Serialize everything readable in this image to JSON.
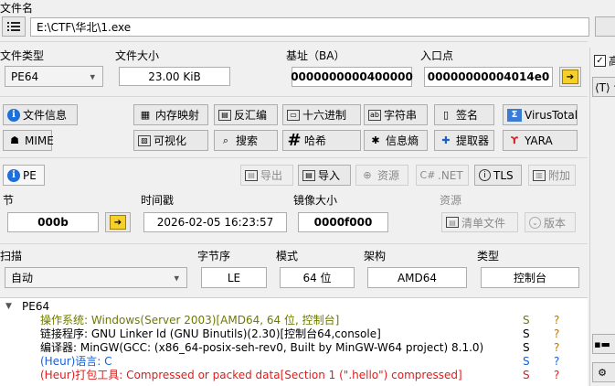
{
  "file": {
    "label": "文件名",
    "path": "E:\\CTF\\华北\\1.exe"
  },
  "info": {
    "type_label": "文件类型",
    "type_value": "PE64",
    "size_label": "文件大小",
    "size_value": "23.00 KiB",
    "base_label": "基址（BA）",
    "base_value": "0000000000400000",
    "entry_label": "入口点",
    "entry_value": "00000000004014e0"
  },
  "tools_row1": [
    {
      "label": "文件信息",
      "icon": "info-icon"
    },
    {
      "label": "内存映射",
      "icon": "memory-icon"
    },
    {
      "label": "反汇编",
      "icon": "disasm-icon"
    },
    {
      "label": "十六进制",
      "icon": "hex-icon"
    },
    {
      "label": "字符串",
      "icon": "strings-icon"
    },
    {
      "label": "签名",
      "icon": "signature-icon"
    },
    {
      "label": "VirusTotal",
      "icon": "virustotal-icon"
    }
  ],
  "tools_row2": [
    {
      "label": "MIME",
      "icon": "mime-icon"
    },
    {
      "label": "可视化",
      "icon": "image-icon"
    },
    {
      "label": "搜索",
      "icon": "search-icon"
    },
    {
      "label": "哈希",
      "icon": "hash-icon"
    },
    {
      "label": "信息熵",
      "icon": "entropy-icon"
    },
    {
      "label": "提取器",
      "icon": "extractor-icon"
    },
    {
      "label": "YARA",
      "icon": "yara-icon"
    }
  ],
  "pe_bar": {
    "pe": "PE",
    "export": "导出",
    "import": "导入",
    "resources": "资源",
    "net": ".NET",
    "tls": "TLS",
    "overlay": "附加"
  },
  "sections": {
    "sections_label": "节",
    "sections_value": "000b",
    "timestamp_label": "时间戳",
    "timestamp_value": "2026-02-05 16:23:57",
    "image_size_label": "镜像大小",
    "image_size_value": "0000f000",
    "resources_label": "资源",
    "manifest_label": "清单文件",
    "version_label": "版本"
  },
  "scan": {
    "scan_label": "扫描",
    "scan_value": "自动",
    "endian_label": "字节序",
    "endian_value": "LE",
    "mode_label": "模式",
    "mode_value": "64 位",
    "arch_label": "架构",
    "arch_value": "AMD64",
    "type_label": "类型",
    "type_value": "控制台"
  },
  "results": {
    "root": "PE64",
    "items": [
      {
        "text": "操作系统: Windows(Server 2003)[AMD64, 64 位, 控制台]",
        "s": "S",
        "q": "?",
        "color": "#6e7a00"
      },
      {
        "text": "链接程序: GNU Linker ld (GNU Binutils)(2.30)[控制台64,console]",
        "s": "S",
        "q": "?",
        "color": "#000000"
      },
      {
        "text": "编译器: MinGW(GCC: (x86_64-posix-seh-rev0, Built by MinGW-W64 project) 8.1.0)",
        "s": "S",
        "q": "?",
        "color": "#000000"
      },
      {
        "text": "(Heur)语言: C",
        "s": "S",
        "q": "?",
        "color": "#1a5fd6"
      },
      {
        "text": "(Heur)打包工具: Compressed or packed data[Section 1 (\".hello\") compressed]",
        "s": "S",
        "q": "?",
        "color": "#e01a1a"
      }
    ]
  },
  "right_panel": {
    "checkbox_label": "高",
    "tag_label": "⟨T⟩ 论"
  },
  "colors": {
    "accent": "#f5cf2a",
    "warn_q": "#b07a00",
    "s_green": "#6e7a00"
  }
}
